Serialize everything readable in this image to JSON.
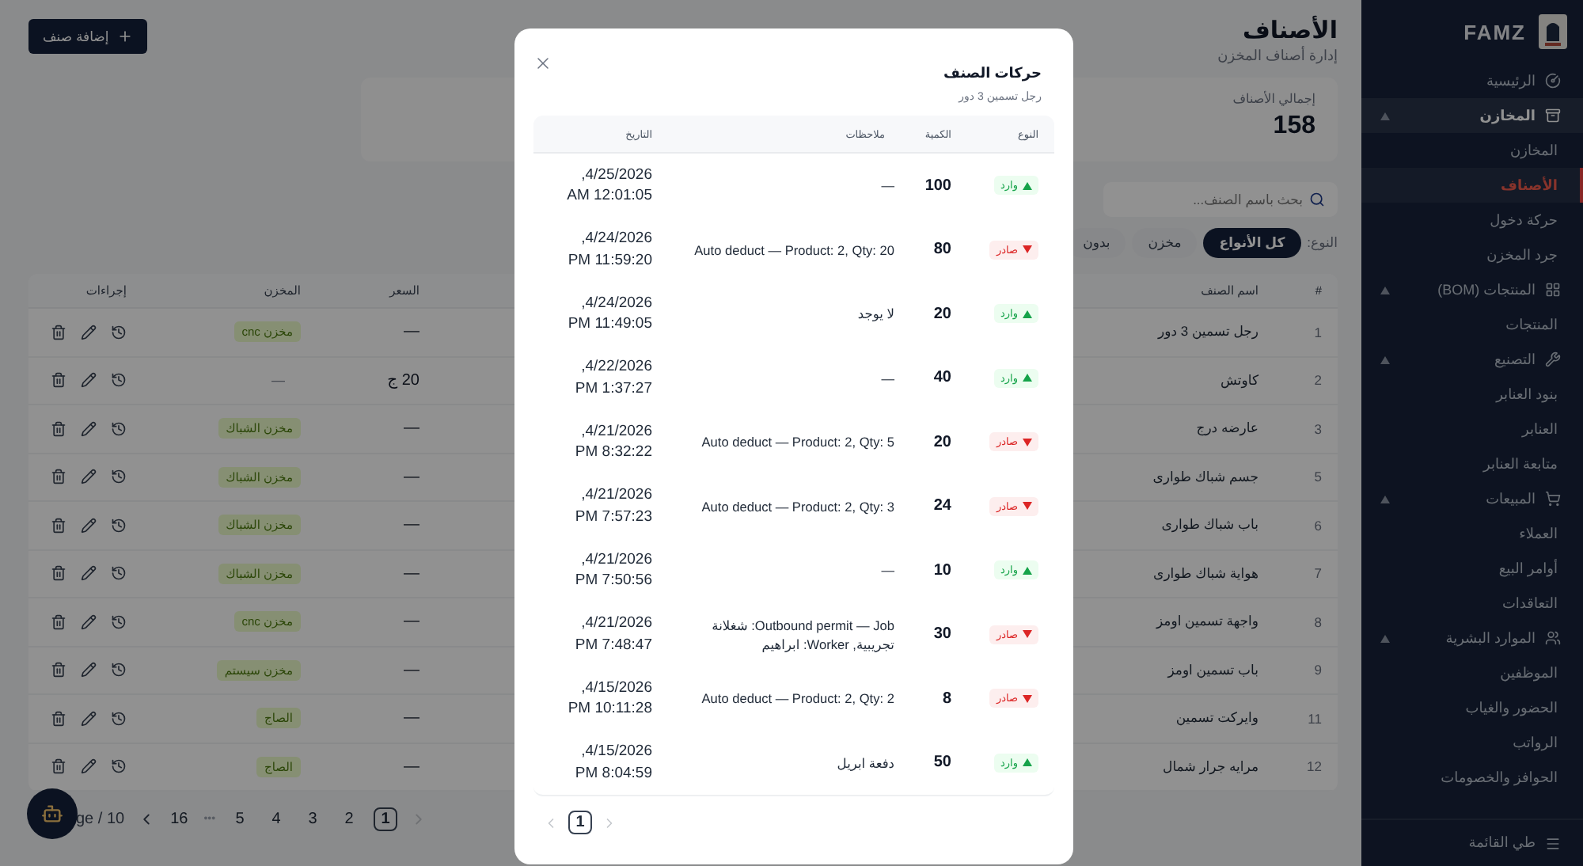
{
  "sidebar": {
    "brand": "FAMZ",
    "items": [
      {
        "label": "الرئيسية",
        "selected": false
      },
      {
        "label": "المخازن",
        "selected": true,
        "expanded": true,
        "children": [
          {
            "label": "المخازن",
            "selected": false
          },
          {
            "label": "الأصناف",
            "selected": true
          },
          {
            "label": "حركة دخول",
            "selected": false
          },
          {
            "label": "جرد المخزن",
            "selected": false
          }
        ]
      },
      {
        "label": "المنتجات (BOM)",
        "selected": false,
        "expanded": true,
        "children": [
          {
            "label": "المنتجات",
            "selected": false
          }
        ]
      },
      {
        "label": "التصنيع",
        "selected": false,
        "expanded": true,
        "children": [
          {
            "label": "بنود العنابر",
            "selected": false
          },
          {
            "label": "العنابر",
            "selected": false
          },
          {
            "label": "متابعة العنابر",
            "selected": false
          }
        ]
      },
      {
        "label": "المبيعات",
        "selected": false,
        "expanded": true,
        "children": [
          {
            "label": "العملاء",
            "selected": false
          },
          {
            "label": "أوامر البيع",
            "selected": false
          },
          {
            "label": "التعاقدات",
            "selected": false
          }
        ]
      },
      {
        "label": "الموارد البشرية",
        "selected": false,
        "expanded": true,
        "children": [
          {
            "label": "الموظفين",
            "selected": false
          },
          {
            "label": "الحضور والغياب",
            "selected": false
          },
          {
            "label": "الرواتب",
            "selected": false
          },
          {
            "label": "الحوافز والخصومات",
            "selected": false
          }
        ]
      }
    ],
    "collapse": "طي القائمة"
  },
  "page": {
    "title": "الأصناف",
    "subtitle": "إدارة أصناف المخزن",
    "add_button": "إضافة صنف"
  },
  "stat": {
    "label": "إجمالي الأصناف",
    "value": "158"
  },
  "search": {
    "placeholder": "بحث باسم الصنف..."
  },
  "filter": {
    "label": "النوع:",
    "options": [
      {
        "label": "كل الأنواع",
        "selected": true
      },
      {
        "label": "مخزن",
        "selected": false
      },
      {
        "label": "بدون",
        "selected": false
      }
    ]
  },
  "table": {
    "columns": {
      "number": "#",
      "name": "اسم الصنف",
      "price": "السعر",
      "warehouse": "المخزن",
      "actions": "إجراءات"
    },
    "rows": [
      {
        "number": "1",
        "name": "رجل تسمين 3 دور",
        "price": "—",
        "warehouse": "مخزن cnc",
        "warehouse_badge": true
      },
      {
        "number": "2",
        "name": "كاوتش",
        "price": "20 ج",
        "warehouse": "—",
        "warehouse_badge": false
      },
      {
        "number": "3",
        "name": "عارضه درج",
        "price": "—",
        "warehouse": "مخزن الشباك",
        "warehouse_badge": true
      },
      {
        "number": "5",
        "name": "جسم شباك طوارى",
        "price": "—",
        "warehouse": "مخزن الشباك",
        "warehouse_badge": true
      },
      {
        "number": "6",
        "name": "باب شباك طوارى",
        "price": "—",
        "warehouse": "مخزن الشباك",
        "warehouse_badge": true
      },
      {
        "number": "7",
        "name": "هواية شباك طوارى",
        "price": "—",
        "warehouse": "مخزن الشباك",
        "warehouse_badge": true
      },
      {
        "number": "8",
        "name": "واجهة تسمين اومز",
        "price": "—",
        "warehouse": "مخزن cnc",
        "warehouse_badge": true
      },
      {
        "number": "9",
        "name": "باب تسمين اومز",
        "price": "—",
        "warehouse": "مخزن سيستم",
        "warehouse_badge": true
      },
      {
        "number": "11",
        "name": "وايركت تسمين",
        "price": "—",
        "warehouse": "الصاج",
        "warehouse_badge": true
      },
      {
        "number": "12",
        "name": "مرايه جرار شمال",
        "price": "—",
        "warehouse": "الصاج",
        "warehouse_badge": true
      }
    ]
  },
  "pagination": {
    "previous_disabled": true,
    "next_disabled": false,
    "pages": [
      {
        "label": "1",
        "selected": true
      },
      {
        "label": "2",
        "selected": false
      },
      {
        "label": "3",
        "selected": false
      },
      {
        "label": "4",
        "selected": false
      },
      {
        "label": "5",
        "selected": false
      }
    ],
    "ellipsis": "•••",
    "last_page": "16",
    "page_size": "ge / 10"
  },
  "modal": {
    "title": "حركات الصنف",
    "subtitle": "رجل تسمين 3 دور",
    "columns": {
      "type": "النوع",
      "quantity": "الكمية",
      "notes": "ملاحظات",
      "date": "التاريخ"
    },
    "rows": [
      {
        "kind": "in",
        "type": "وارد",
        "quantity": "100",
        "notes": "—",
        "date": "4/25/2026, 12:01:05 AM"
      },
      {
        "kind": "out",
        "type": "صادر",
        "quantity": "80",
        "notes": "Auto deduct — Product: 2, Qty: 20",
        "date": "4/24/2026, 11:59:20 PM"
      },
      {
        "kind": "in",
        "type": "وارد",
        "quantity": "20",
        "notes": "لا يوجد",
        "date": "4/24/2026, 11:49:05 PM"
      },
      {
        "kind": "in",
        "type": "وارد",
        "quantity": "40",
        "notes": "—",
        "date": "4/22/2026, 1:37:27 PM"
      },
      {
        "kind": "out",
        "type": "صادر",
        "quantity": "20",
        "notes": "Auto deduct — Product: 2, Qty: 5",
        "date": "4/21/2026, 8:32:22 PM"
      },
      {
        "kind": "out",
        "type": "صادر",
        "quantity": "24",
        "notes": "Auto deduct — Product: 2, Qty: 3",
        "date": "4/21/2026, 7:57:23 PM"
      },
      {
        "kind": "in",
        "type": "وارد",
        "quantity": "10",
        "notes": "—",
        "date": "4/21/2026, 7:50:56 PM"
      },
      {
        "kind": "out",
        "type": "صادر",
        "quantity": "30",
        "notes": "Outbound permit — Job: شغلانة تجريبية, Worker: ابراهيم",
        "date": "4/21/2026, 7:48:47 PM"
      },
      {
        "kind": "out",
        "type": "صادر",
        "quantity": "8",
        "notes": "Auto deduct — Product: 2, Qty: 2",
        "date": "4/15/2026, 10:11:28 PM"
      },
      {
        "kind": "in",
        "type": "وارد",
        "quantity": "50",
        "notes": "دفعة ابريل",
        "date": "4/15/2026, 8:04:59 PM"
      }
    ],
    "pagination": {
      "previous_disabled": true,
      "next_disabled": true,
      "pages": [
        {
          "label": "1",
          "selected": true
        }
      ]
    }
  }
}
